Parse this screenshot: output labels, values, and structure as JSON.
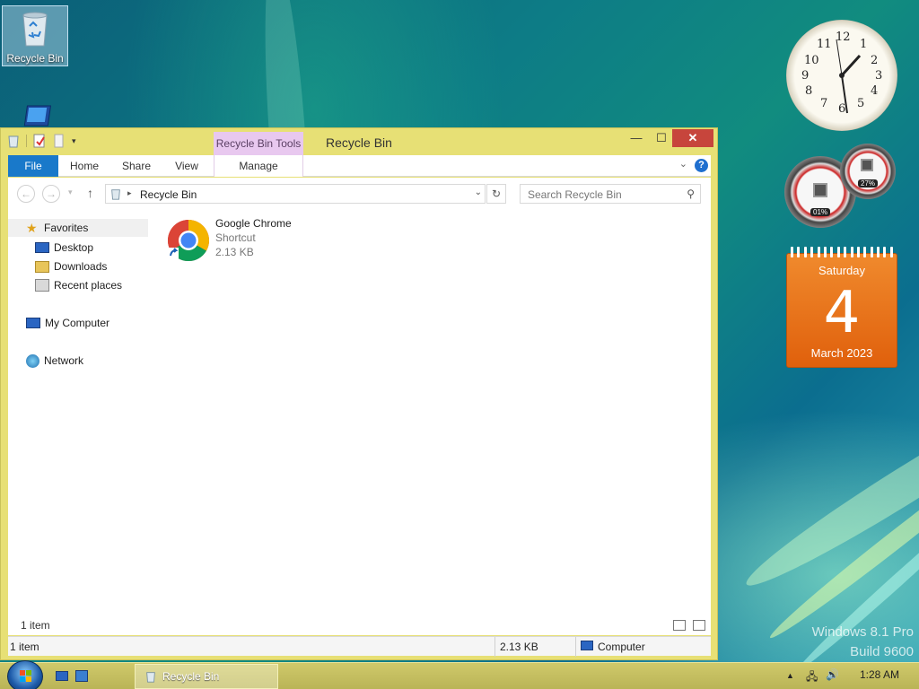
{
  "desktop": {
    "icons": [
      {
        "label": "Recycle Bin"
      }
    ],
    "watermark_line1": "Windows 8.1 Pro",
    "watermark_line2": "Build 9600"
  },
  "window": {
    "title": "Recycle Bin",
    "context_tab_header": "Recycle Bin Tools",
    "ribbon_tabs": {
      "file": "File",
      "home": "Home",
      "share": "Share",
      "view": "View",
      "manage": "Manage"
    },
    "help_label": "?",
    "address": {
      "path": "Recycle Bin"
    },
    "search": {
      "placeholder": "Search Recycle Bin"
    },
    "nav": {
      "favorites": "Favorites",
      "desktop": "Desktop",
      "downloads": "Downloads",
      "recent_places": "Recent places",
      "my_computer": "My Computer",
      "network": "Network"
    },
    "files": [
      {
        "name": "Google Chrome",
        "type": "Shortcut",
        "size": "2.13 KB"
      }
    ],
    "status_strip_count": "1 item",
    "statusbar": {
      "items": "1 item",
      "size": "2.13 KB",
      "location": "Computer"
    }
  },
  "gadgets": {
    "clock_numbers": [
      "12",
      "1",
      "2",
      "3",
      "4",
      "5",
      "6",
      "7",
      "8",
      "9",
      "10",
      "11"
    ],
    "cpu_meter": {
      "cpu": "01%",
      "memory": "27%"
    },
    "calendar": {
      "weekday": "Saturday",
      "day": "4",
      "month_year": "March 2023"
    }
  },
  "taskbar": {
    "active_app": "Recycle Bin",
    "time": "1:28 AM"
  },
  "colors": {
    "window_frame": "#e7e075",
    "context_tab": "#e8c8ef",
    "file_tab": "#1979ca",
    "close_button": "#c7453c",
    "calendar": "#e8701a"
  }
}
